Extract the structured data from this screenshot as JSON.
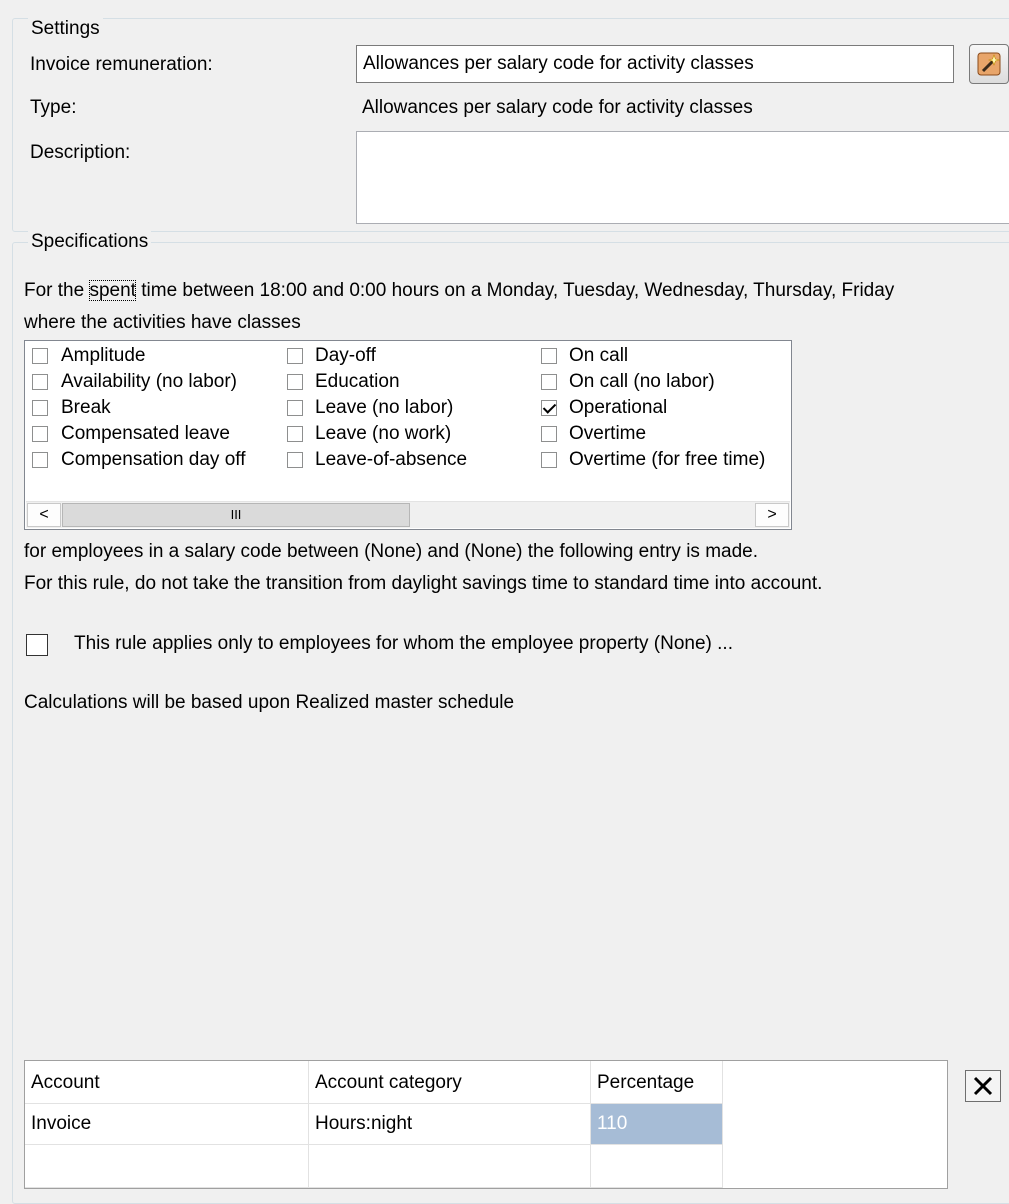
{
  "settings": {
    "group_title": "Settings",
    "invoice_remuneration_label": "Invoice remuneration:",
    "invoice_remuneration_value": "Allowances per salary code for activity classes",
    "type_label": "Type:",
    "type_value": "Allowances per salary code for activity classes",
    "description_label": "Description:",
    "description_value": "",
    "wizard_icon": "magic-wand-icon"
  },
  "specifications": {
    "group_title": "Specifications",
    "line1_pre": "For the",
    "line1_link": "spent",
    "line1_post": "time between 18:00 and 0:00 hours on a Monday, Tuesday, Wednesday, Thursday, Friday",
    "line2": "where the activities have classes",
    "classes": [
      {
        "label": "Amplitude",
        "checked": false
      },
      {
        "label": "Availability (no labor)",
        "checked": false
      },
      {
        "label": "Break",
        "checked": false
      },
      {
        "label": "Compensated leave",
        "checked": false
      },
      {
        "label": "Compensation day off",
        "checked": false
      },
      {
        "label": "Day-off",
        "checked": false
      },
      {
        "label": "Education",
        "checked": false
      },
      {
        "label": "Leave (no labor)",
        "checked": false
      },
      {
        "label": "Leave (no work)",
        "checked": false
      },
      {
        "label": "Leave-of-absence",
        "checked": false
      },
      {
        "label": "On call",
        "checked": false
      },
      {
        "label": "On call (no labor)",
        "checked": false
      },
      {
        "label": "Operational",
        "checked": true
      },
      {
        "label": "Overtime",
        "checked": false
      },
      {
        "label": "Overtime (for free time)",
        "checked": false
      }
    ],
    "scroll_left": "<",
    "scroll_right": ">",
    "scroll_thumb": "III",
    "line3": "for employees in a salary code between (None) and (None) the following entry is made.",
    "line4_pre": "For this rule,",
    "line4_link": "do not",
    "line4_post": "take the transition from daylight savings time to standard time into account.",
    "property_rule_label": "This rule applies only to employees for whom the employee property (None) ...",
    "property_rule_checked": false,
    "calc_line": "Calculations will be based upon Realized master schedule"
  },
  "grid": {
    "headers": [
      "Account",
      "Account category",
      "Percentage"
    ],
    "rows": [
      {
        "account": "Invoice",
        "category": "Hours:night",
        "percentage": "110"
      }
    ],
    "delete_icon": "close-x-icon"
  }
}
